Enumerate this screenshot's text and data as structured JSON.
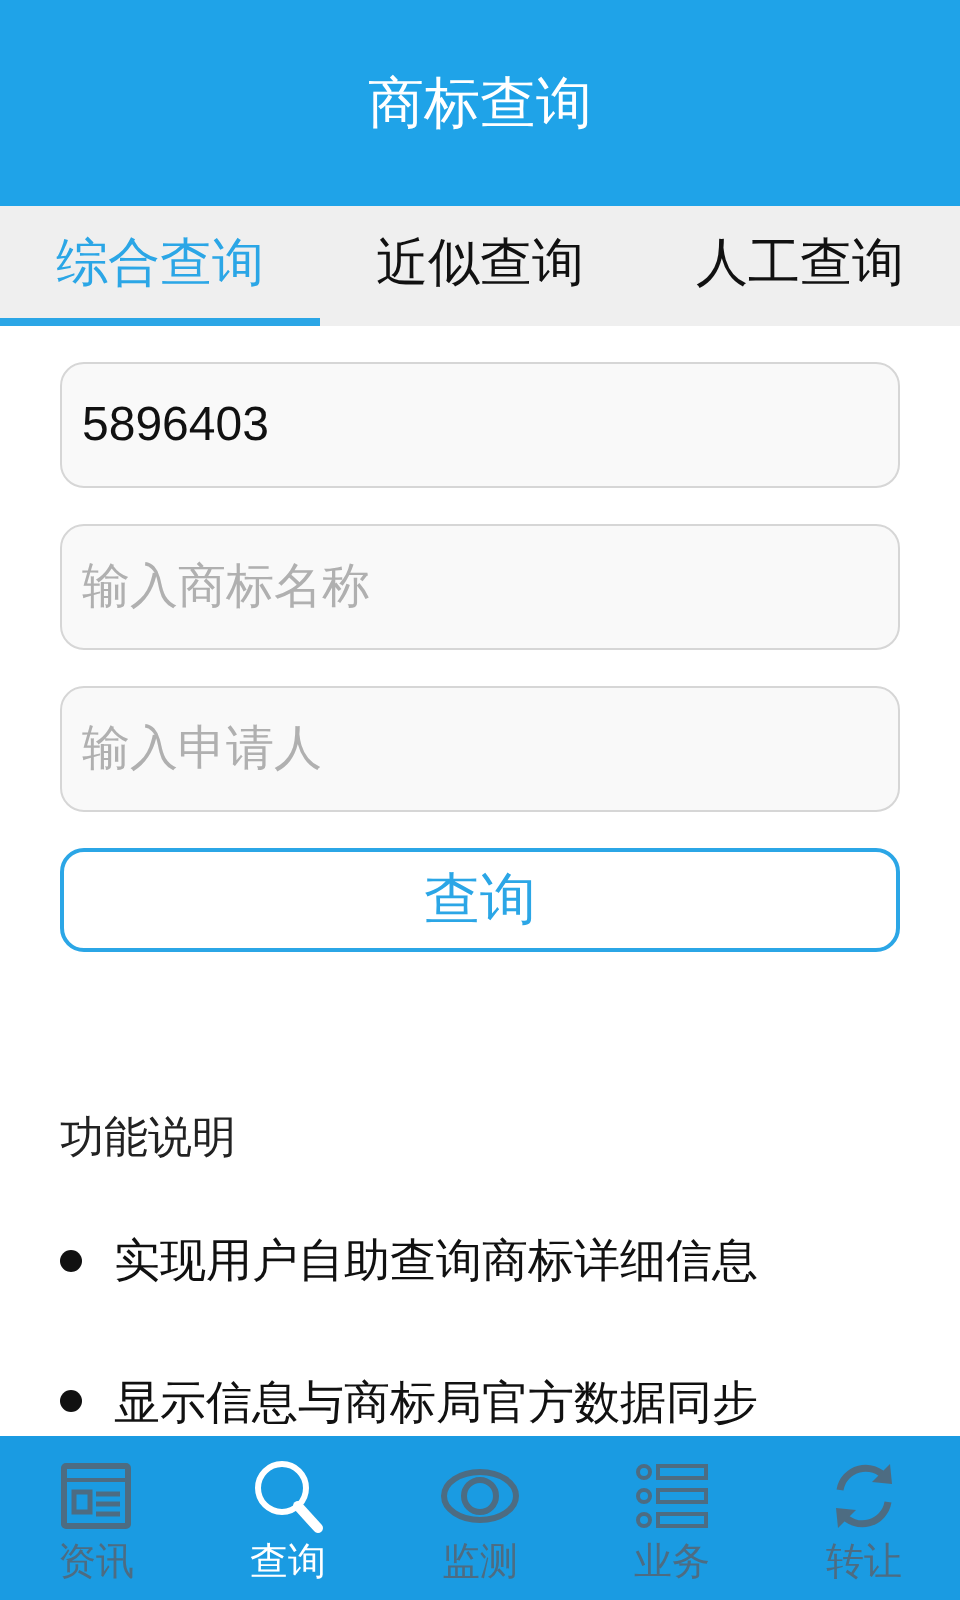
{
  "header": {
    "title": "商标查询"
  },
  "tabs": [
    {
      "label": "综合查询",
      "selected": true
    },
    {
      "label": "近似查询",
      "selected": false
    },
    {
      "label": "人工查询",
      "selected": false
    }
  ],
  "fields": [
    {
      "value": "5896403"
    },
    {
      "placeholder": "输入商标名称"
    },
    {
      "placeholder": "输入申请人"
    }
  ],
  "search_button": "查询",
  "info": {
    "title": "功能说明",
    "items": [
      "实现用户自助查询商标详细信息",
      "显示信息与商标局官方数据同步"
    ]
  },
  "nav": [
    {
      "label": "资讯",
      "kind": "news",
      "selected": false
    },
    {
      "label": "查询",
      "kind": "search",
      "selected": true
    },
    {
      "label": "监测",
      "kind": "eye",
      "selected": false
    },
    {
      "label": "业务",
      "kind": "list",
      "selected": false
    },
    {
      "label": "转让",
      "kind": "sync",
      "selected": false
    }
  ]
}
